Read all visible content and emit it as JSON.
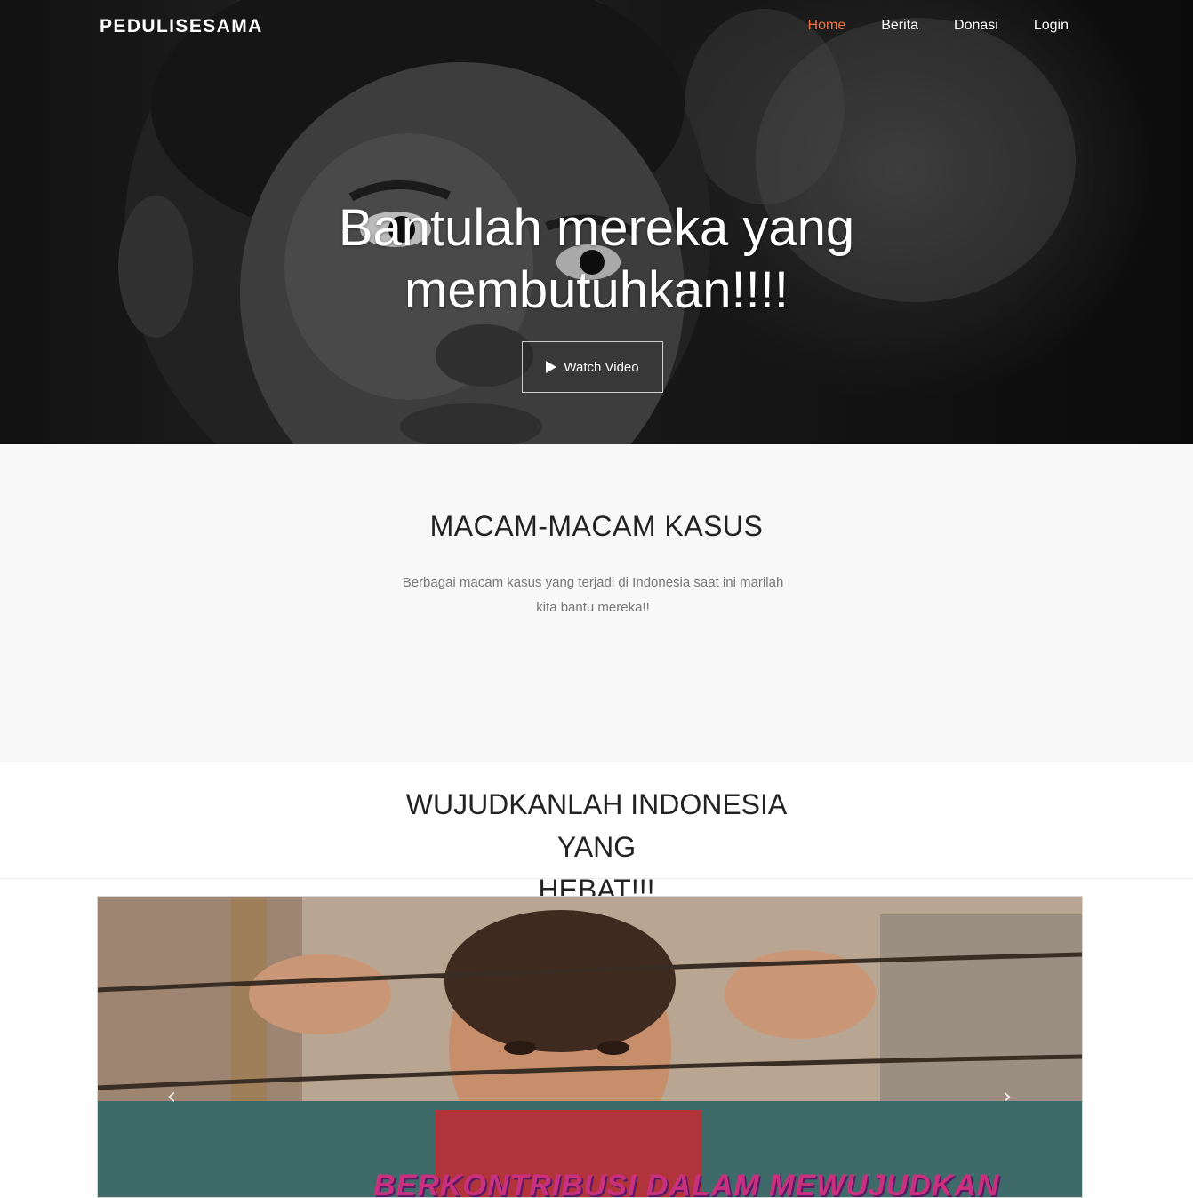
{
  "navbar": {
    "brand": "PEDULISESAMA",
    "links": [
      {
        "label": "Home",
        "active": true
      },
      {
        "label": "Berita",
        "active": false
      },
      {
        "label": "Donasi",
        "active": false
      },
      {
        "label": "Login",
        "active": false
      }
    ],
    "active_color": "#f2723b"
  },
  "hero": {
    "title_line1": "Bantulah mereka yang",
    "title_line2": "membutuhkan!!!!",
    "watch_button": "Watch Video",
    "play_icon": "play-icon"
  },
  "cases": {
    "title": "MACAM-MACAM KASUS",
    "desc_line1": "Berbagai macam kasus yang terjadi di Indonesia saat ini marilah",
    "desc_line2": "kita bantu mereka!!"
  },
  "hebat": {
    "title_line1": "WUJUDKANLAH INDONESIA YANG",
    "title_line2": "HEBAT!!!"
  },
  "carousel": {
    "prev_icon": "chevron-left-icon",
    "next_icon": "chevron-right-icon",
    "prev_glyph": "‹",
    "next_glyph": "›",
    "caption": "BERKONTRIBUSI DALAM MEWUJUDKAN"
  }
}
